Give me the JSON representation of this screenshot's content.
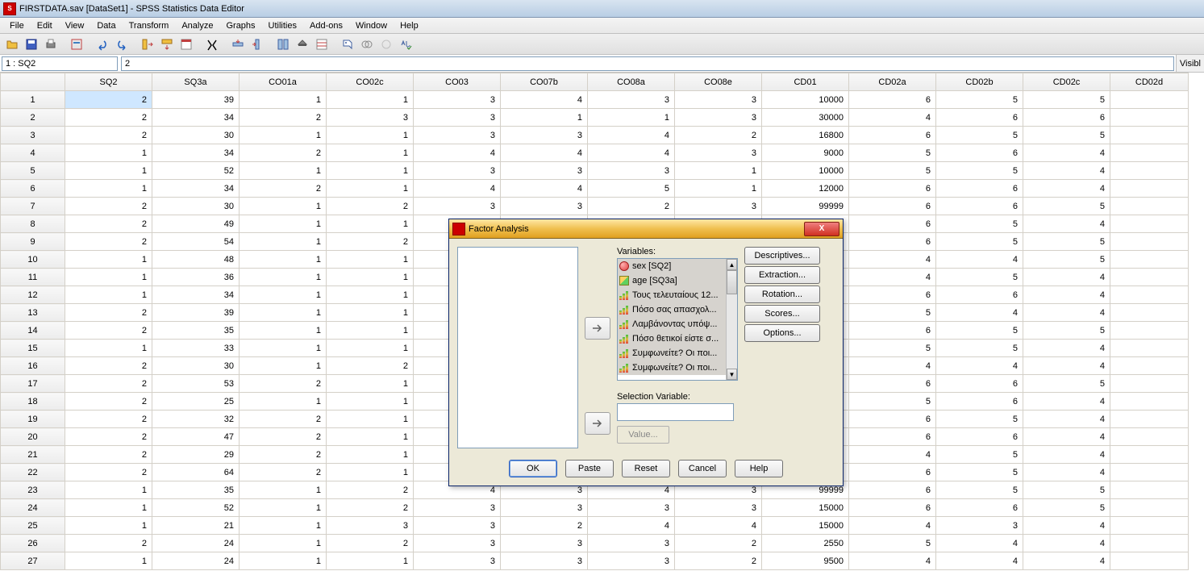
{
  "window": {
    "title": "FIRSTDATA.sav [DataSet1] - SPSS Statistics Data Editor"
  },
  "menu": {
    "items": [
      "File",
      "Edit",
      "View",
      "Data",
      "Transform",
      "Analyze",
      "Graphs",
      "Utilities",
      "Add-ons",
      "Window",
      "Help"
    ]
  },
  "cellbar": {
    "ref": "1 : SQ2",
    "value": "2",
    "visible": "Visibl"
  },
  "columns": [
    "SQ2",
    "SQ3a",
    "CO01a",
    "CO02c",
    "CO03",
    "CO07b",
    "CO08a",
    "CO08e",
    "CD01",
    "CD02a",
    "CD02b",
    "CD02c",
    "CD02d"
  ],
  "rows": [
    [
      "2",
      "39",
      "1",
      "1",
      "3",
      "4",
      "3",
      "3",
      "10000",
      "6",
      "5",
      "5",
      ""
    ],
    [
      "2",
      "34",
      "2",
      "3",
      "3",
      "1",
      "1",
      "3",
      "30000",
      "4",
      "6",
      "6",
      ""
    ],
    [
      "2",
      "30",
      "1",
      "1",
      "3",
      "3",
      "4",
      "2",
      "16800",
      "6",
      "5",
      "5",
      ""
    ],
    [
      "1",
      "34",
      "2",
      "1",
      "4",
      "4",
      "4",
      "3",
      "9000",
      "5",
      "6",
      "4",
      ""
    ],
    [
      "1",
      "52",
      "1",
      "1",
      "3",
      "3",
      "3",
      "1",
      "10000",
      "5",
      "5",
      "4",
      ""
    ],
    [
      "1",
      "34",
      "2",
      "1",
      "4",
      "4",
      "5",
      "1",
      "12000",
      "6",
      "6",
      "4",
      ""
    ],
    [
      "2",
      "30",
      "1",
      "2",
      "3",
      "3",
      "2",
      "3",
      "99999",
      "6",
      "6",
      "5",
      ""
    ],
    [
      "2",
      "49",
      "1",
      "1",
      "",
      "",
      "",
      "",
      "",
      "6",
      "5",
      "4",
      ""
    ],
    [
      "2",
      "54",
      "1",
      "2",
      "",
      "",
      "",
      "",
      "",
      "6",
      "5",
      "5",
      ""
    ],
    [
      "1",
      "48",
      "1",
      "1",
      "",
      "",
      "",
      "",
      "",
      "4",
      "4",
      "5",
      ""
    ],
    [
      "1",
      "36",
      "1",
      "1",
      "",
      "",
      "",
      "",
      "",
      "4",
      "5",
      "4",
      ""
    ],
    [
      "1",
      "34",
      "1",
      "1",
      "",
      "",
      "",
      "",
      "",
      "6",
      "6",
      "4",
      ""
    ],
    [
      "2",
      "39",
      "1",
      "1",
      "",
      "",
      "",
      "",
      "",
      "5",
      "4",
      "4",
      ""
    ],
    [
      "2",
      "35",
      "1",
      "1",
      "",
      "",
      "",
      "",
      "",
      "6",
      "5",
      "5",
      ""
    ],
    [
      "1",
      "33",
      "1",
      "1",
      "",
      "",
      "",
      "",
      "",
      "5",
      "5",
      "4",
      ""
    ],
    [
      "2",
      "30",
      "1",
      "2",
      "",
      "",
      "",
      "",
      "",
      "4",
      "4",
      "4",
      ""
    ],
    [
      "2",
      "53",
      "2",
      "1",
      "",
      "",
      "",
      "",
      "",
      "6",
      "6",
      "5",
      ""
    ],
    [
      "2",
      "25",
      "1",
      "1",
      "",
      "",
      "",
      "",
      "",
      "5",
      "6",
      "4",
      ""
    ],
    [
      "2",
      "32",
      "2",
      "1",
      "",
      "",
      "",
      "",
      "",
      "6",
      "5",
      "4",
      ""
    ],
    [
      "2",
      "47",
      "2",
      "1",
      "",
      "",
      "",
      "",
      "",
      "6",
      "6",
      "4",
      ""
    ],
    [
      "2",
      "29",
      "2",
      "1",
      "",
      "",
      "",
      "",
      "",
      "4",
      "5",
      "4",
      ""
    ],
    [
      "2",
      "64",
      "2",
      "1",
      "",
      "",
      "",
      "",
      "",
      "6",
      "5",
      "4",
      ""
    ],
    [
      "1",
      "35",
      "1",
      "2",
      "4",
      "3",
      "4",
      "3",
      "99999",
      "6",
      "5",
      "5",
      ""
    ],
    [
      "1",
      "52",
      "1",
      "2",
      "3",
      "3",
      "3",
      "3",
      "15000",
      "6",
      "6",
      "5",
      ""
    ],
    [
      "1",
      "21",
      "1",
      "3",
      "3",
      "2",
      "4",
      "4",
      "15000",
      "4",
      "3",
      "4",
      ""
    ],
    [
      "2",
      "24",
      "1",
      "2",
      "3",
      "3",
      "3",
      "2",
      "2550",
      "5",
      "4",
      "4",
      ""
    ],
    [
      "1",
      "24",
      "1",
      "1",
      "3",
      "3",
      "3",
      "2",
      "9500",
      "4",
      "4",
      "4",
      ""
    ]
  ],
  "dialog": {
    "title": "Factor Analysis",
    "variables_label": "Variables:",
    "variables": [
      {
        "type": "nominal",
        "label": "sex [SQ2]"
      },
      {
        "type": "scale",
        "label": "age [SQ3a]"
      },
      {
        "type": "ordinal",
        "label": "Τους τελευταίους 12..."
      },
      {
        "type": "ordinal",
        "label": "Πόσο σας απασχολ..."
      },
      {
        "type": "ordinal",
        "label": "Λαμβάνοντας υπόψ..."
      },
      {
        "type": "ordinal",
        "label": "Πόσο θετικοί είστε σ..."
      },
      {
        "type": "ordinal",
        "label": "Συμφωνείτε? Οι ποι..."
      },
      {
        "type": "ordinal",
        "label": "Συμφωνείτε? Οι ποι..."
      }
    ],
    "selection_label": "Selection Variable:",
    "value_btn": "Value...",
    "side_buttons": [
      "Descriptives...",
      "Extraction...",
      "Rotation...",
      "Scores...",
      "Options..."
    ],
    "bottom_buttons": [
      "OK",
      "Paste",
      "Reset",
      "Cancel",
      "Help"
    ]
  }
}
